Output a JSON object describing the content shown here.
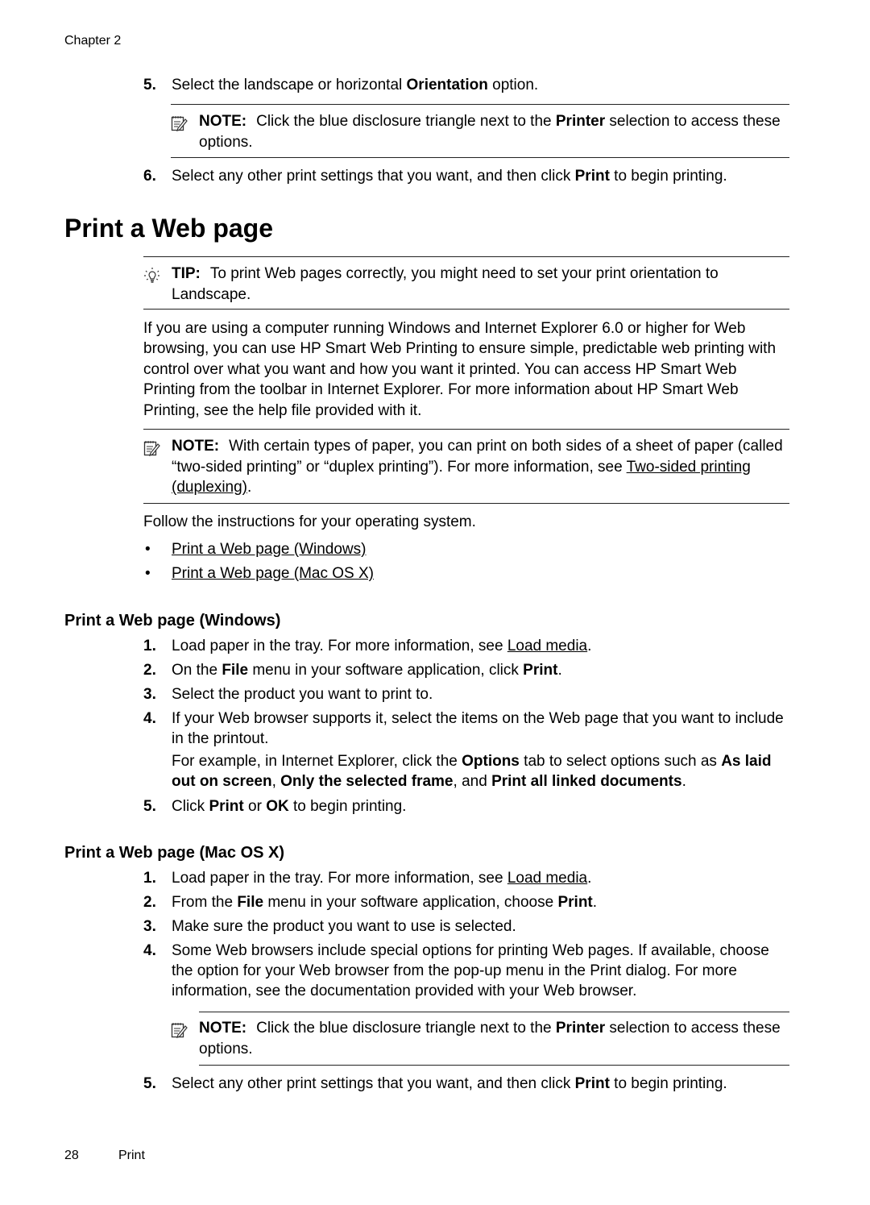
{
  "header": {
    "chapter": "Chapter 2"
  },
  "top_steps": [
    {
      "num": "5.",
      "pre": "Select the landscape or horizontal ",
      "bold": "Orientation",
      "post": " option."
    },
    {
      "num": "6.",
      "pre": "Select any other print settings that you want, and then click ",
      "bold": "Print",
      "post": " to begin printing."
    }
  ],
  "top_note": {
    "label": "NOTE:",
    "pre": "Click the blue disclosure triangle next to the ",
    "bold": "Printer",
    "post": " selection to access these options."
  },
  "section": {
    "title": "Print a Web page",
    "tip": {
      "label": "TIP:",
      "text": "To print Web pages correctly, you might need to set your print orientation to Landscape."
    },
    "intro": "If you are using a computer running Windows and Internet Explorer 6.0 or higher for Web browsing, you can use HP Smart Web Printing to ensure simple, predictable web printing with control over what you want and how you want it printed. You can access HP Smart Web Printing from the toolbar in Internet Explorer. For more information about HP Smart Web Printing, see the help file provided with it.",
    "note": {
      "label": "NOTE:",
      "pre": "With certain types of paper, you can print on both sides of a sheet of paper (called “two-sided printing” or “duplex printing”). For more information, see ",
      "link": "Two-sided printing (duplexing)",
      "post": "."
    },
    "follow": "Follow the instructions for your operating system.",
    "links": [
      "Print a Web page (Windows)",
      "Print a Web page (Mac OS X)"
    ]
  },
  "windows": {
    "title": "Print a Web page (Windows)",
    "step1": {
      "num": "1.",
      "pre": "Load paper in the tray. For more information, see ",
      "link": "Load media",
      "post": "."
    },
    "step2": {
      "num": "2.",
      "pre": "On the ",
      "b1": "File",
      "mid": " menu in your software application, click ",
      "b2": "Print",
      "post": "."
    },
    "step3": {
      "num": "3.",
      "text": "Select the product you want to print to."
    },
    "step4": {
      "num": "4.",
      "text": "If your Web browser supports it, select the items on the Web page that you want to include in the printout.",
      "ex_pre": "For example, in Internet Explorer, click the ",
      "ex_b1": "Options",
      "ex_mid1": " tab to select options such as ",
      "ex_b2": "As laid out on screen",
      "ex_mid2": ", ",
      "ex_b3": "Only the selected frame",
      "ex_mid3": ", and ",
      "ex_b4": "Print all linked documents",
      "ex_post": "."
    },
    "step5": {
      "num": "5.",
      "pre": "Click ",
      "b1": "Print",
      "mid": " or ",
      "b2": "OK",
      "post": " to begin printing."
    }
  },
  "mac": {
    "title": "Print a Web page (Mac OS X)",
    "step1": {
      "num": "1.",
      "pre": "Load paper in the tray. For more information, see ",
      "link": "Load media",
      "post": "."
    },
    "step2": {
      "num": "2.",
      "pre": "From the ",
      "b1": "File",
      "mid": " menu in your software application, choose ",
      "b2": "Print",
      "post": "."
    },
    "step3": {
      "num": "3.",
      "text": "Make sure the product you want to use is selected."
    },
    "step4": {
      "num": "4.",
      "text": "Some Web browsers include special options for printing Web pages. If available, choose the option for your Web browser from the pop-up menu in the Print dialog. For more information, see the documentation provided with your Web browser."
    },
    "note": {
      "label": "NOTE:",
      "pre": "Click the blue disclosure triangle next to the ",
      "bold": "Printer",
      "post": " selection to access these options."
    },
    "step5": {
      "num": "5.",
      "pre": "Select any other print settings that you want, and then click ",
      "bold": "Print",
      "post": " to begin printing."
    }
  },
  "footer": {
    "page_number": "28",
    "section": "Print"
  }
}
